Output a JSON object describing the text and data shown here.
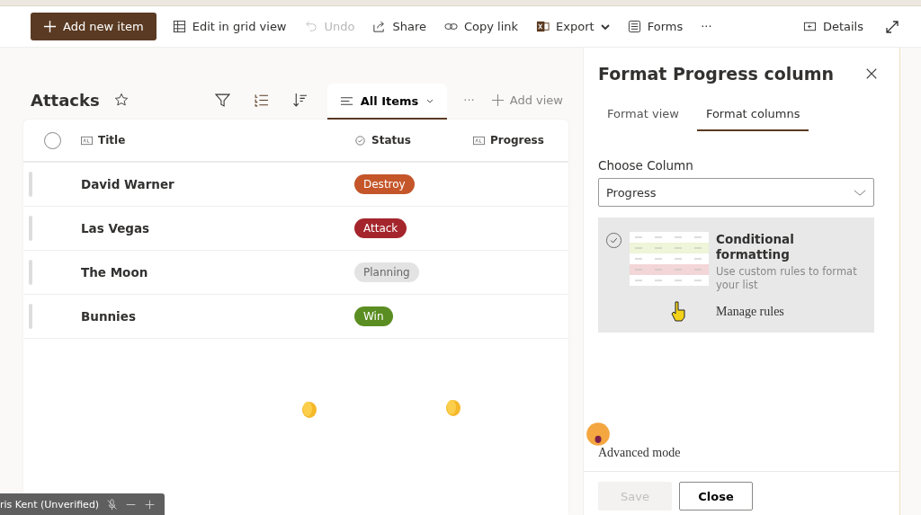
{
  "toolbar": {
    "items": [
      {
        "kind": "add",
        "label": "Add new item",
        "disabled": false
      },
      {
        "kind": "grid",
        "label": "Edit in grid view",
        "disabled": false
      },
      {
        "kind": "undo",
        "label": "Undo",
        "disabled": true
      },
      {
        "kind": "share",
        "label": "Share",
        "disabled": false
      },
      {
        "kind": "link",
        "label": "Copy link",
        "disabled": false
      },
      {
        "kind": "export",
        "label": "Export",
        "disabled": false
      },
      {
        "kind": "forms",
        "label": "Forms",
        "disabled": false
      },
      {
        "kind": "more",
        "label": "···",
        "disabled": false
      }
    ],
    "details": "Details"
  },
  "list": {
    "title": "Attacks",
    "all_selected": false,
    "view": "All Items",
    "more": "···",
    "add_view": "Add view",
    "columns": [
      {
        "kind": "text",
        "label": "Title"
      },
      {
        "kind": "choice",
        "label": "Status"
      },
      {
        "kind": "text",
        "label": "Progress"
      }
    ],
    "rows": [
      {
        "title": "David Warner",
        "status": {
          "label": "Destroy",
          "color": "#c4562a"
        }
      },
      {
        "title": "Las Vegas",
        "status": {
          "label": "Attack",
          "color": "#a4262c"
        }
      },
      {
        "title": "The Moon",
        "status": {
          "label": "Planning",
          "color": "#e3e3e3"
        }
      },
      {
        "title": "Bunnies",
        "status": {
          "label": "Win",
          "color": "#5b8e22"
        }
      }
    ]
  },
  "panel": {
    "title": "Format Progress column",
    "tabs": [
      {
        "label": "Format view",
        "selected": false
      },
      {
        "label": "Format columns",
        "selected": true
      }
    ],
    "field_label": "Choose Column",
    "column_value": "Progress",
    "option": {
      "title": "Conditional formatting",
      "description": "Use custom rules to format your list",
      "link": "Manage rules",
      "selected": true
    },
    "advanced": "Advanced mode",
    "buttons": [
      {
        "label": "Save",
        "disabled": true
      },
      {
        "label": "Close",
        "disabled": false
      }
    ]
  },
  "meeting_bar": {
    "name": "ris Kent (Unverified)"
  }
}
